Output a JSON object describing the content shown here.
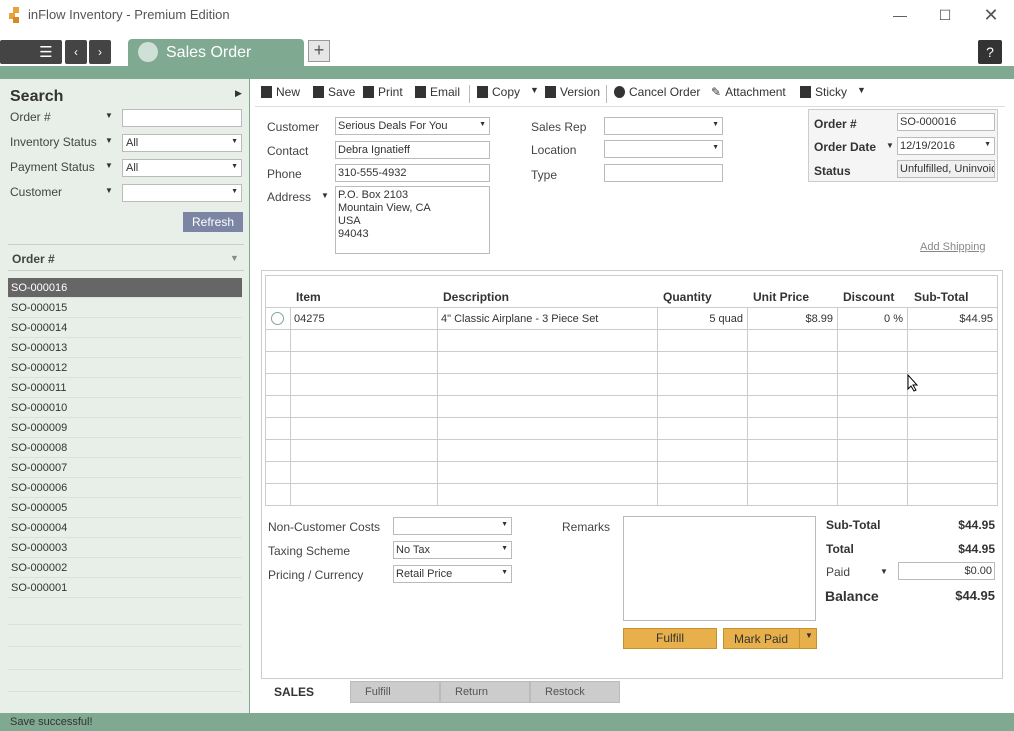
{
  "window": {
    "title": "inFlow Inventory - Premium Edition"
  },
  "tabs": {
    "active": "Sales Order"
  },
  "search": {
    "title": "Search",
    "filters": [
      {
        "label": "Order #",
        "value": ""
      },
      {
        "label": "Inventory Status",
        "value": "All"
      },
      {
        "label": "Payment Status",
        "value": "All"
      },
      {
        "label": "Customer",
        "value": ""
      }
    ],
    "refresh": "Refresh",
    "list_header": "Order #",
    "orders": [
      "SO-000016",
      "SO-000015",
      "SO-000014",
      "SO-000013",
      "SO-000012",
      "SO-000011",
      "SO-000010",
      "SO-000009",
      "SO-000008",
      "SO-000007",
      "SO-000006",
      "SO-000005",
      "SO-000004",
      "SO-000003",
      "SO-000002",
      "SO-000001"
    ]
  },
  "toolbar": {
    "new": "New",
    "save": "Save",
    "print": "Print",
    "email": "Email",
    "copy": "Copy",
    "version": "Version",
    "cancel": "Cancel Order",
    "attachment": "Attachment",
    "sticky": "Sticky"
  },
  "form": {
    "customer_label": "Customer",
    "customer": "Serious Deals For You",
    "contact_label": "Contact",
    "contact": "Debra Ignatieff",
    "phone_label": "Phone",
    "phone": "310-555-4932",
    "address_label": "Address",
    "address": [
      "P.O. Box 2103",
      "Mountain View, CA",
      "USA",
      "94043"
    ],
    "salesrep_label": "Sales Rep",
    "salesrep": "",
    "location_label": "Location",
    "location": "",
    "type_label": "Type",
    "type": "",
    "ordernum_label": "Order #",
    "ordernum": "SO-000016",
    "orderdate_label": "Order Date",
    "orderdate": "12/19/2016",
    "status_label": "Status",
    "status": "Unfulfilled, Uninvoic",
    "add_shipping": "Add Shipping"
  },
  "grid": {
    "headers": [
      "Item",
      "Description",
      "Quantity",
      "Unit Price",
      "Discount",
      "Sub-Total"
    ],
    "rows": [
      {
        "item": "04275",
        "description": "4\" Classic Airplane - 3 Piece Set",
        "quantity": "5 quad",
        "unit_price": "$8.99",
        "discount": "0 %",
        "subtotal": "$44.95"
      }
    ]
  },
  "bottom": {
    "noncust_label": "Non-Customer Costs",
    "noncust": "",
    "taxing_label": "Taxing Scheme",
    "taxing": "No Tax",
    "pricing_label": "Pricing / Currency",
    "pricing": "Retail Price",
    "remarks_label": "Remarks",
    "subtotal_label": "Sub-Total",
    "subtotal": "$44.95",
    "total_label": "Total",
    "total": "$44.95",
    "paid_label": "Paid",
    "paid": "$0.00",
    "balance_label": "Balance",
    "balance": "$44.95",
    "fulfill": "Fulfill",
    "mark_paid": "Mark Paid"
  },
  "bottom_tabs": [
    "SALES",
    "Fulfill",
    "Return",
    "Restock"
  ],
  "status": "Save successful!",
  "colors": {
    "accent": "#7fa990",
    "button": "#e8b04a",
    "refresh": "#7c86a4"
  }
}
